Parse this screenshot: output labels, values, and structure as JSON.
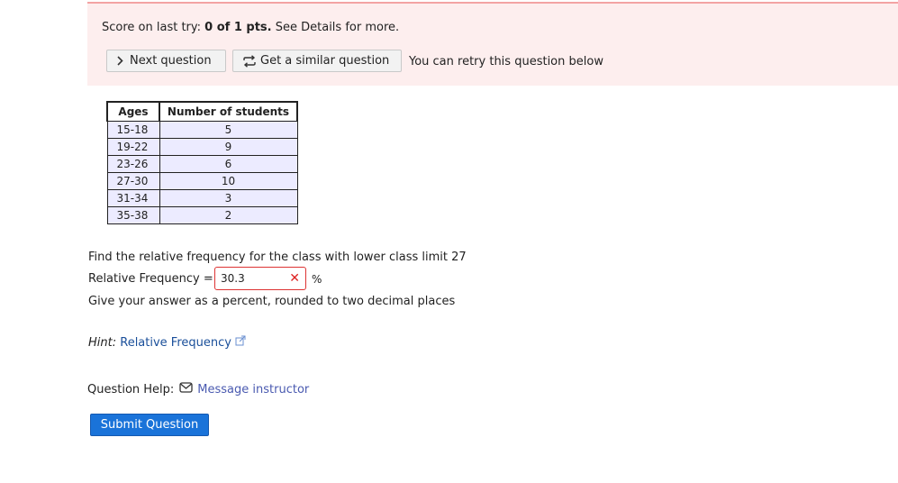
{
  "banner": {
    "score_prefix": "Score on last try: ",
    "score_value": "0 of 1 pts.",
    "score_suffix": " See Details for more.",
    "next_label": "Next question",
    "similar_label": "Get a similar question",
    "retry_note": "You can retry this question below",
    "colors": {
      "background": "#fdeeee",
      "border": "#f3a3a3"
    }
  },
  "table": {
    "headers": [
      "Ages",
      "Number of students"
    ],
    "rows": [
      [
        "15-18",
        "5"
      ],
      [
        "19-22",
        "9"
      ],
      [
        "23-26",
        "6"
      ],
      [
        "27-30",
        "10"
      ],
      [
        "31-34",
        "3"
      ],
      [
        "35-38",
        "2"
      ]
    ]
  },
  "question": {
    "prompt": "Find the relative frequency for the class with lower class limit 27",
    "field_label": "Relative Frequency =",
    "answer_value": "30.3",
    "answer_status": "incorrect",
    "unit": "%",
    "instruction": "Give your answer as a percent, rounded to two decimal places"
  },
  "hint": {
    "label": "Hint:",
    "link_text": "Relative Frequency"
  },
  "help": {
    "label": "Question Help:",
    "message_link": "Message instructor"
  },
  "submit_label": "Submit Question",
  "icons": {
    "next": "chevron-right-icon",
    "similar": "refresh-icon",
    "wrong": "x-mark-icon",
    "external": "external-link-icon",
    "mail": "envelope-icon"
  }
}
